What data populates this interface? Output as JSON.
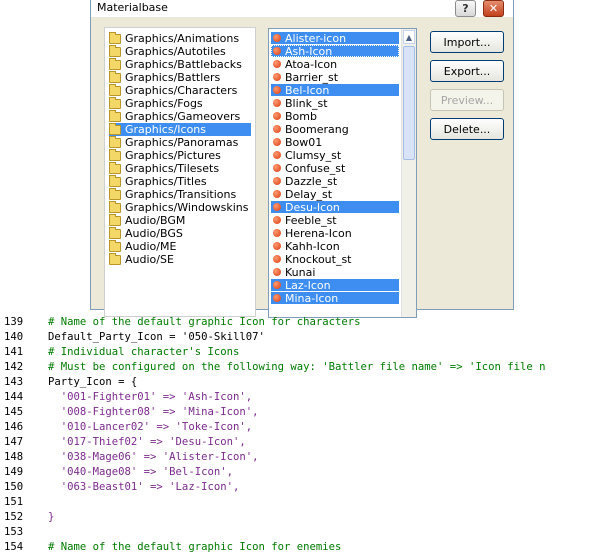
{
  "dialog": {
    "title": "Materialbase",
    "help_label": "?",
    "close_label": "✕",
    "folders": [
      {
        "label": "Graphics/Animations",
        "selected": false
      },
      {
        "label": "Graphics/Autotiles",
        "selected": false
      },
      {
        "label": "Graphics/Battlebacks",
        "selected": false
      },
      {
        "label": "Graphics/Battlers",
        "selected": false
      },
      {
        "label": "Graphics/Characters",
        "selected": false
      },
      {
        "label": "Graphics/Fogs",
        "selected": false
      },
      {
        "label": "Graphics/Gameovers",
        "selected": false
      },
      {
        "label": "Graphics/Icons",
        "selected": true
      },
      {
        "label": "Graphics/Panoramas",
        "selected": false
      },
      {
        "label": "Graphics/Pictures",
        "selected": false
      },
      {
        "label": "Graphics/Tilesets",
        "selected": false
      },
      {
        "label": "Graphics/Titles",
        "selected": false
      },
      {
        "label": "Graphics/Transitions",
        "selected": false
      },
      {
        "label": "Graphics/Windowskins",
        "selected": false
      },
      {
        "label": "Audio/BGM",
        "selected": false
      },
      {
        "label": "Audio/BGS",
        "selected": false
      },
      {
        "label": "Audio/ME",
        "selected": false
      },
      {
        "label": "Audio/SE",
        "selected": false
      }
    ],
    "files": [
      {
        "label": "Alister-icon",
        "selected": true
      },
      {
        "label": "Ash-Icon",
        "selected": true
      },
      {
        "label": "Atoa-Icon",
        "selected": false
      },
      {
        "label": "Barrier_st",
        "selected": false
      },
      {
        "label": "Bel-Icon",
        "selected": true
      },
      {
        "label": "Blink_st",
        "selected": false
      },
      {
        "label": "Bomb",
        "selected": false
      },
      {
        "label": "Boomerang",
        "selected": false
      },
      {
        "label": "Bow01",
        "selected": false
      },
      {
        "label": "Clumsy_st",
        "selected": false
      },
      {
        "label": "Confuse_st",
        "selected": false
      },
      {
        "label": "Dazzle_st",
        "selected": false
      },
      {
        "label": "Delay_st",
        "selected": false
      },
      {
        "label": "Desu-Icon",
        "selected": true
      },
      {
        "label": "Feeble_st",
        "selected": false
      },
      {
        "label": "Herena-Icon",
        "selected": false
      },
      {
        "label": "Kahh-Icon",
        "selected": false
      },
      {
        "label": "Knockout_st",
        "selected": false
      },
      {
        "label": "Kunai",
        "selected": false
      },
      {
        "label": "Laz-Icon",
        "selected": true
      },
      {
        "label": "Mina-Icon",
        "selected": true
      }
    ],
    "buttons": {
      "import": "Import...",
      "export": "Export...",
      "preview": "Preview...",
      "delete": "Delete..."
    },
    "icons": {
      "folder": "folder-icon",
      "file": "red-ball-icon"
    }
  },
  "code": {
    "lines": [
      {
        "num": "139",
        "text": "# Name of the default graphic Icon for characters",
        "kind": "comment"
      },
      {
        "num": "140",
        "text": "Default_Party_Icon = '050-Skill07'",
        "kind": "plain"
      },
      {
        "num": "141",
        "text": "# Individual character's Icons",
        "kind": "comment"
      },
      {
        "num": "142",
        "text": "# Must be configured on the following way: 'Battler file name' => 'Icon file n",
        "kind": "comment"
      },
      {
        "num": "143",
        "text": "Party_Icon = {",
        "kind": "plain"
      },
      {
        "num": "144",
        "text": "  '001-Fighter01' => 'Ash-Icon',",
        "kind": "string"
      },
      {
        "num": "145",
        "text": "  '008-Fighter08' => 'Mina-Icon',",
        "kind": "string"
      },
      {
        "num": "146",
        "text": "  '010-Lancer02' => 'Toke-Icon',",
        "kind": "string"
      },
      {
        "num": "147",
        "text": "  '017-Thief02' => 'Desu-Icon',",
        "kind": "string"
      },
      {
        "num": "148",
        "text": "  '038-Mage06' => 'Alister-Icon',",
        "kind": "string"
      },
      {
        "num": "149",
        "text": "  '040-Mage08' => 'Bel-Icon',",
        "kind": "string"
      },
      {
        "num": "150",
        "text": "  '063-Beast01' => 'Laz-Icon',",
        "kind": "string"
      },
      {
        "num": "151",
        "text": "",
        "kind": "plain"
      },
      {
        "num": "152",
        "text": "}",
        "kind": "string"
      },
      {
        "num": "153",
        "text": "",
        "kind": "plain"
      },
      {
        "num": "154",
        "text": "# Name of the default graphic Icon for enemies",
        "kind": "comment"
      }
    ]
  },
  "colors": {
    "selection": "#3d8ef0",
    "comment": "#007a00",
    "string": "#7b2a8c"
  }
}
